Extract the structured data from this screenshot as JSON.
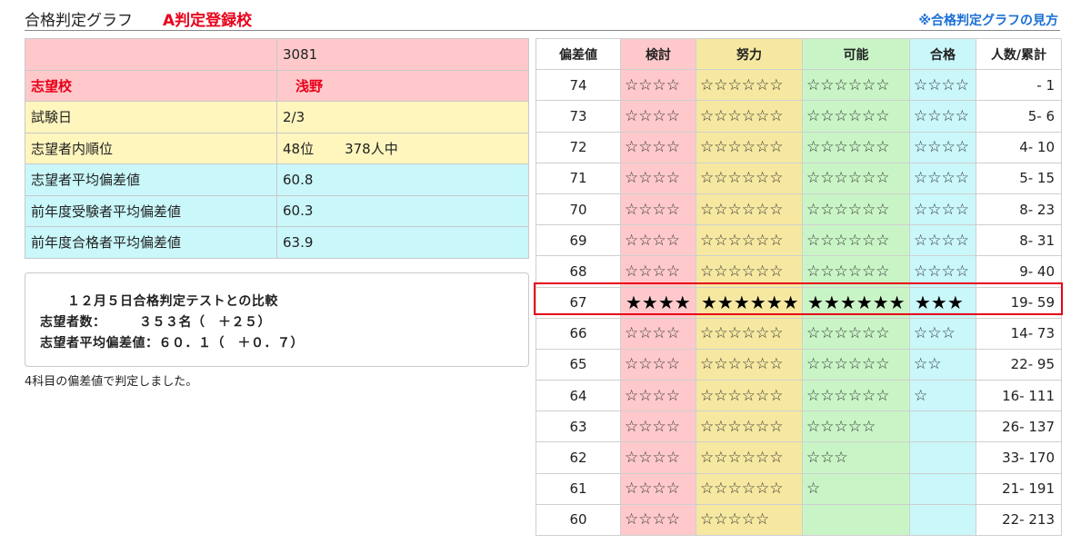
{
  "header": {
    "title": "合格判定グラフ",
    "badge": "A判定登録校",
    "help_link": "※合格判定グラフの見方"
  },
  "info": {
    "rows": [
      {
        "label": "",
        "value": "3081"
      },
      {
        "label": "志望校",
        "value": "浅野"
      },
      {
        "label": "試験日",
        "value": "2/3"
      },
      {
        "label": "志望者内順位",
        "value": "48位",
        "extra": "378人中"
      },
      {
        "label": "志望者平均偏差値",
        "value": "60.8"
      },
      {
        "label": "前年度受験者平均偏差値",
        "value": "60.3"
      },
      {
        "label": "前年度合格者平均偏差値",
        "value": "63.9"
      }
    ]
  },
  "compare": {
    "title": "１２月５日合格判定テストとの比較",
    "line1": "志望者数：　　　３５３名（　＋２５）",
    "line2": "志望者平均偏差値：６０．１（　＋０．７）"
  },
  "note": "4科目の偏差値で判定しました。",
  "grade_table": {
    "headers": [
      "偏差値",
      "検討",
      "努力",
      "可能",
      "合格",
      "人数/累計"
    ],
    "highlight_value": 67,
    "rows": [
      {
        "dev": "74",
        "ken": "☆☆☆☆",
        "dor": "☆☆☆☆☆☆",
        "kan": "☆☆☆☆☆☆",
        "gou": "☆☆☆☆",
        "num": "-   1"
      },
      {
        "dev": "73",
        "ken": "☆☆☆☆",
        "dor": "☆☆☆☆☆☆",
        "kan": "☆☆☆☆☆☆",
        "gou": "☆☆☆☆",
        "num": "5-   6"
      },
      {
        "dev": "72",
        "ken": "☆☆☆☆",
        "dor": "☆☆☆☆☆☆",
        "kan": "☆☆☆☆☆☆",
        "gou": "☆☆☆☆",
        "num": "4-  10"
      },
      {
        "dev": "71",
        "ken": "☆☆☆☆",
        "dor": "☆☆☆☆☆☆",
        "kan": "☆☆☆☆☆☆",
        "gou": "☆☆☆☆",
        "num": "5-  15"
      },
      {
        "dev": "70",
        "ken": "☆☆☆☆",
        "dor": "☆☆☆☆☆☆",
        "kan": "☆☆☆☆☆☆",
        "gou": "☆☆☆☆",
        "num": "8-  23"
      },
      {
        "dev": "69",
        "ken": "☆☆☆☆",
        "dor": "☆☆☆☆☆☆",
        "kan": "☆☆☆☆☆☆",
        "gou": "☆☆☆☆",
        "num": "8-  31"
      },
      {
        "dev": "68",
        "ken": "☆☆☆☆",
        "dor": "☆☆☆☆☆☆",
        "kan": "☆☆☆☆☆☆",
        "gou": "☆☆☆☆",
        "num": "9-  40"
      },
      {
        "dev": "67",
        "ken": "★★★★",
        "dor": "★★★★★★",
        "kan": "★★★★★★",
        "gou": "★★★",
        "num": "19-  59"
      },
      {
        "dev": "66",
        "ken": "☆☆☆☆",
        "dor": "☆☆☆☆☆☆",
        "kan": "☆☆☆☆☆☆",
        "gou": "☆☆☆",
        "num": "14-  73"
      },
      {
        "dev": "65",
        "ken": "☆☆☆☆",
        "dor": "☆☆☆☆☆☆",
        "kan": "☆☆☆☆☆☆",
        "gou": "☆☆",
        "num": "22-  95"
      },
      {
        "dev": "64",
        "ken": "☆☆☆☆",
        "dor": "☆☆☆☆☆☆",
        "kan": "☆☆☆☆☆☆",
        "gou": "☆",
        "num": "16- 111"
      },
      {
        "dev": "63",
        "ken": "☆☆☆☆",
        "dor": "☆☆☆☆☆☆",
        "kan": "☆☆☆☆☆",
        "gou": "",
        "num": "26- 137"
      },
      {
        "dev": "62",
        "ken": "☆☆☆☆",
        "dor": "☆☆☆☆☆☆",
        "kan": "☆☆☆",
        "gou": "",
        "num": "33- 170"
      },
      {
        "dev": "61",
        "ken": "☆☆☆☆",
        "dor": "☆☆☆☆☆☆",
        "kan": "☆",
        "gou": "",
        "num": "21- 191"
      },
      {
        "dev": "60",
        "ken": "☆☆☆☆",
        "dor": "☆☆☆☆☆",
        "kan": "",
        "gou": "",
        "num": "22- 213"
      }
    ]
  },
  "colors": {
    "accent_red": "#e8001a",
    "link_blue": "#1a6fd6",
    "pink": "#ffc9cb",
    "yellow": "#fff6be",
    "cyan": "#c9f7fa",
    "green": "#c9f5c6",
    "sand": "#f6e8a0"
  }
}
